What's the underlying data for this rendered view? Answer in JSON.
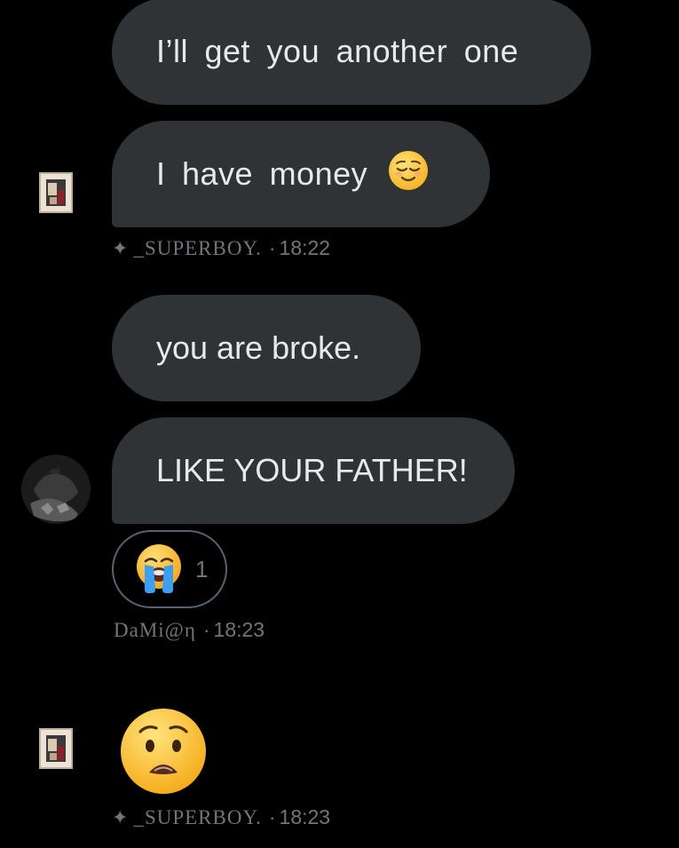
{
  "messages": [
    {
      "text": "I’ll get you another one"
    },
    {
      "text": "I have money",
      "emoji": "relieved-face"
    },
    {
      "text": "you are broke."
    },
    {
      "text": "LIKE YOUR FATHER!"
    }
  ],
  "meta": {
    "superboy_1": {
      "spark": "✦",
      "name": "_SUPERBOY.",
      "time": "18:22"
    },
    "damian": {
      "name": "DaMi@η",
      "time": "18:23"
    },
    "superboy_2": {
      "spark": "✦",
      "name": "_SUPERBOY.",
      "time": "18:23"
    }
  },
  "reaction": {
    "emoji": "loudly-crying-face",
    "count": "1"
  },
  "big_emoji": "anguished-face",
  "separator": "·",
  "colors": {
    "background": "#000000",
    "bubble": "#2f3336",
    "text": "#e7e9ea",
    "muted": "#71767b",
    "reaction_border": "#536471",
    "emoji_yellow": "#ffcc33"
  }
}
